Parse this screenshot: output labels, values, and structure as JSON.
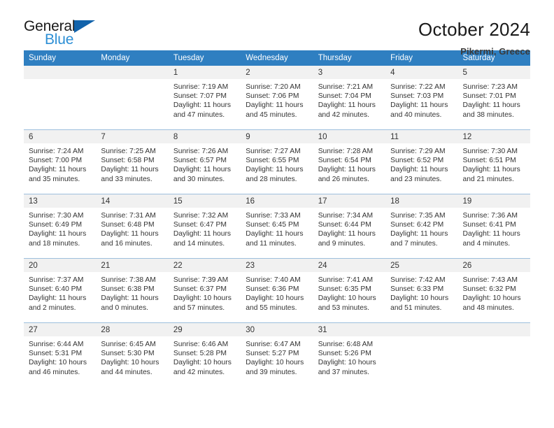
{
  "brand": {
    "name_top": "General",
    "name_bottom": "Blue",
    "flag_icon": "triangle-flag-icon",
    "accent_color": "#2d8fd5",
    "flag_color": "#1263ab"
  },
  "header": {
    "title": "October 2024",
    "subtitle": "Pikermi, Greece"
  },
  "theme": {
    "header_row_bg": "#2f7fc1",
    "daynum_bg": "#f1f1f1",
    "grid_line": "#9dbfdd"
  },
  "weekdays": [
    "Sunday",
    "Monday",
    "Tuesday",
    "Wednesday",
    "Thursday",
    "Friday",
    "Saturday"
  ],
  "weeks": [
    [
      {
        "day": "",
        "empty": true,
        "sunrise": "",
        "sunset": "",
        "daylight1": "",
        "daylight2": ""
      },
      {
        "day": "",
        "empty": true,
        "sunrise": "",
        "sunset": "",
        "daylight1": "",
        "daylight2": ""
      },
      {
        "day": "1",
        "empty": false,
        "sunrise": "Sunrise: 7:19 AM",
        "sunset": "Sunset: 7:07 PM",
        "daylight1": "Daylight: 11 hours",
        "daylight2": "and 47 minutes."
      },
      {
        "day": "2",
        "empty": false,
        "sunrise": "Sunrise: 7:20 AM",
        "sunset": "Sunset: 7:06 PM",
        "daylight1": "Daylight: 11 hours",
        "daylight2": "and 45 minutes."
      },
      {
        "day": "3",
        "empty": false,
        "sunrise": "Sunrise: 7:21 AM",
        "sunset": "Sunset: 7:04 PM",
        "daylight1": "Daylight: 11 hours",
        "daylight2": "and 42 minutes."
      },
      {
        "day": "4",
        "empty": false,
        "sunrise": "Sunrise: 7:22 AM",
        "sunset": "Sunset: 7:03 PM",
        "daylight1": "Daylight: 11 hours",
        "daylight2": "and 40 minutes."
      },
      {
        "day": "5",
        "empty": false,
        "sunrise": "Sunrise: 7:23 AM",
        "sunset": "Sunset: 7:01 PM",
        "daylight1": "Daylight: 11 hours",
        "daylight2": "and 38 minutes."
      }
    ],
    [
      {
        "day": "6",
        "empty": false,
        "sunrise": "Sunrise: 7:24 AM",
        "sunset": "Sunset: 7:00 PM",
        "daylight1": "Daylight: 11 hours",
        "daylight2": "and 35 minutes."
      },
      {
        "day": "7",
        "empty": false,
        "sunrise": "Sunrise: 7:25 AM",
        "sunset": "Sunset: 6:58 PM",
        "daylight1": "Daylight: 11 hours",
        "daylight2": "and 33 minutes."
      },
      {
        "day": "8",
        "empty": false,
        "sunrise": "Sunrise: 7:26 AM",
        "sunset": "Sunset: 6:57 PM",
        "daylight1": "Daylight: 11 hours",
        "daylight2": "and 30 minutes."
      },
      {
        "day": "9",
        "empty": false,
        "sunrise": "Sunrise: 7:27 AM",
        "sunset": "Sunset: 6:55 PM",
        "daylight1": "Daylight: 11 hours",
        "daylight2": "and 28 minutes."
      },
      {
        "day": "10",
        "empty": false,
        "sunrise": "Sunrise: 7:28 AM",
        "sunset": "Sunset: 6:54 PM",
        "daylight1": "Daylight: 11 hours",
        "daylight2": "and 26 minutes."
      },
      {
        "day": "11",
        "empty": false,
        "sunrise": "Sunrise: 7:29 AM",
        "sunset": "Sunset: 6:52 PM",
        "daylight1": "Daylight: 11 hours",
        "daylight2": "and 23 minutes."
      },
      {
        "day": "12",
        "empty": false,
        "sunrise": "Sunrise: 7:30 AM",
        "sunset": "Sunset: 6:51 PM",
        "daylight1": "Daylight: 11 hours",
        "daylight2": "and 21 minutes."
      }
    ],
    [
      {
        "day": "13",
        "empty": false,
        "sunrise": "Sunrise: 7:30 AM",
        "sunset": "Sunset: 6:49 PM",
        "daylight1": "Daylight: 11 hours",
        "daylight2": "and 18 minutes."
      },
      {
        "day": "14",
        "empty": false,
        "sunrise": "Sunrise: 7:31 AM",
        "sunset": "Sunset: 6:48 PM",
        "daylight1": "Daylight: 11 hours",
        "daylight2": "and 16 minutes."
      },
      {
        "day": "15",
        "empty": false,
        "sunrise": "Sunrise: 7:32 AM",
        "sunset": "Sunset: 6:47 PM",
        "daylight1": "Daylight: 11 hours",
        "daylight2": "and 14 minutes."
      },
      {
        "day": "16",
        "empty": false,
        "sunrise": "Sunrise: 7:33 AM",
        "sunset": "Sunset: 6:45 PM",
        "daylight1": "Daylight: 11 hours",
        "daylight2": "and 11 minutes."
      },
      {
        "day": "17",
        "empty": false,
        "sunrise": "Sunrise: 7:34 AM",
        "sunset": "Sunset: 6:44 PM",
        "daylight1": "Daylight: 11 hours",
        "daylight2": "and 9 minutes."
      },
      {
        "day": "18",
        "empty": false,
        "sunrise": "Sunrise: 7:35 AM",
        "sunset": "Sunset: 6:42 PM",
        "daylight1": "Daylight: 11 hours",
        "daylight2": "and 7 minutes."
      },
      {
        "day": "19",
        "empty": false,
        "sunrise": "Sunrise: 7:36 AM",
        "sunset": "Sunset: 6:41 PM",
        "daylight1": "Daylight: 11 hours",
        "daylight2": "and 4 minutes."
      }
    ],
    [
      {
        "day": "20",
        "empty": false,
        "sunrise": "Sunrise: 7:37 AM",
        "sunset": "Sunset: 6:40 PM",
        "daylight1": "Daylight: 11 hours",
        "daylight2": "and 2 minutes."
      },
      {
        "day": "21",
        "empty": false,
        "sunrise": "Sunrise: 7:38 AM",
        "sunset": "Sunset: 6:38 PM",
        "daylight1": "Daylight: 11 hours",
        "daylight2": "and 0 minutes."
      },
      {
        "day": "22",
        "empty": false,
        "sunrise": "Sunrise: 7:39 AM",
        "sunset": "Sunset: 6:37 PM",
        "daylight1": "Daylight: 10 hours",
        "daylight2": "and 57 minutes."
      },
      {
        "day": "23",
        "empty": false,
        "sunrise": "Sunrise: 7:40 AM",
        "sunset": "Sunset: 6:36 PM",
        "daylight1": "Daylight: 10 hours",
        "daylight2": "and 55 minutes."
      },
      {
        "day": "24",
        "empty": false,
        "sunrise": "Sunrise: 7:41 AM",
        "sunset": "Sunset: 6:35 PM",
        "daylight1": "Daylight: 10 hours",
        "daylight2": "and 53 minutes."
      },
      {
        "day": "25",
        "empty": false,
        "sunrise": "Sunrise: 7:42 AM",
        "sunset": "Sunset: 6:33 PM",
        "daylight1": "Daylight: 10 hours",
        "daylight2": "and 51 minutes."
      },
      {
        "day": "26",
        "empty": false,
        "sunrise": "Sunrise: 7:43 AM",
        "sunset": "Sunset: 6:32 PM",
        "daylight1": "Daylight: 10 hours",
        "daylight2": "and 48 minutes."
      }
    ],
    [
      {
        "day": "27",
        "empty": false,
        "sunrise": "Sunrise: 6:44 AM",
        "sunset": "Sunset: 5:31 PM",
        "daylight1": "Daylight: 10 hours",
        "daylight2": "and 46 minutes."
      },
      {
        "day": "28",
        "empty": false,
        "sunrise": "Sunrise: 6:45 AM",
        "sunset": "Sunset: 5:30 PM",
        "daylight1": "Daylight: 10 hours",
        "daylight2": "and 44 minutes."
      },
      {
        "day": "29",
        "empty": false,
        "sunrise": "Sunrise: 6:46 AM",
        "sunset": "Sunset: 5:28 PM",
        "daylight1": "Daylight: 10 hours",
        "daylight2": "and 42 minutes."
      },
      {
        "day": "30",
        "empty": false,
        "sunrise": "Sunrise: 6:47 AM",
        "sunset": "Sunset: 5:27 PM",
        "daylight1": "Daylight: 10 hours",
        "daylight2": "and 39 minutes."
      },
      {
        "day": "31",
        "empty": false,
        "sunrise": "Sunrise: 6:48 AM",
        "sunset": "Sunset: 5:26 PM",
        "daylight1": "Daylight: 10 hours",
        "daylight2": "and 37 minutes."
      },
      {
        "day": "",
        "empty": true,
        "sunrise": "",
        "sunset": "",
        "daylight1": "",
        "daylight2": ""
      },
      {
        "day": "",
        "empty": true,
        "sunrise": "",
        "sunset": "",
        "daylight1": "",
        "daylight2": ""
      }
    ]
  ]
}
